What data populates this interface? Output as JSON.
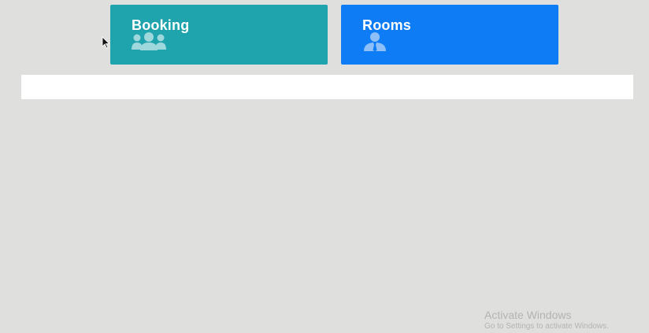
{
  "tiles": {
    "booking": {
      "label": "Booking",
      "icon": "users-icon",
      "color": "#1fa3ad"
    },
    "rooms": {
      "label": "Rooms",
      "icon": "user-tie-icon",
      "color": "#0d7cf5"
    }
  },
  "watermark": {
    "title": "Activate Windows",
    "subtitle": "Go to Settings to activate Windows."
  },
  "colors": {
    "background": "#dfe0de",
    "panel": "#ffffff",
    "watermark": "#b3b4b2"
  }
}
